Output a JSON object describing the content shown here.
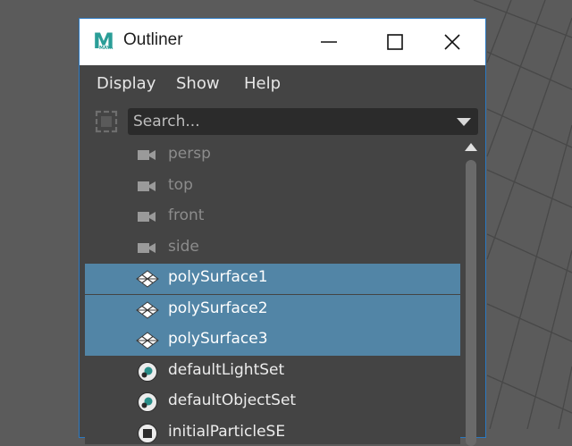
{
  "window": {
    "title": "Outliner",
    "app_icon_letter": "M",
    "app_icon_caption": "MAYA"
  },
  "menubar": {
    "items": [
      "Display",
      "Show",
      "Help"
    ]
  },
  "search": {
    "placeholder": "Search..."
  },
  "outliner": {
    "items": [
      {
        "label": "persp",
        "type": "camera",
        "selected": false
      },
      {
        "label": "top",
        "type": "camera",
        "selected": false
      },
      {
        "label": "front",
        "type": "camera",
        "selected": false
      },
      {
        "label": "side",
        "type": "camera",
        "selected": false
      },
      {
        "label": "polySurface1",
        "type": "mesh",
        "selected": true
      },
      {
        "label": "polySurface2",
        "type": "mesh",
        "selected": true
      },
      {
        "label": "polySurface3",
        "type": "mesh",
        "selected": true
      },
      {
        "label": "defaultLightSet",
        "type": "set",
        "selected": false
      },
      {
        "label": "defaultObjectSet",
        "type": "set",
        "selected": false
      },
      {
        "label": "initialParticleSE",
        "type": "shading-group",
        "selected": false
      }
    ]
  },
  "colors": {
    "selection": "#5285a6",
    "panel": "#444444",
    "viewport": "#5b5b5b",
    "window_border": "#2b79c2"
  }
}
